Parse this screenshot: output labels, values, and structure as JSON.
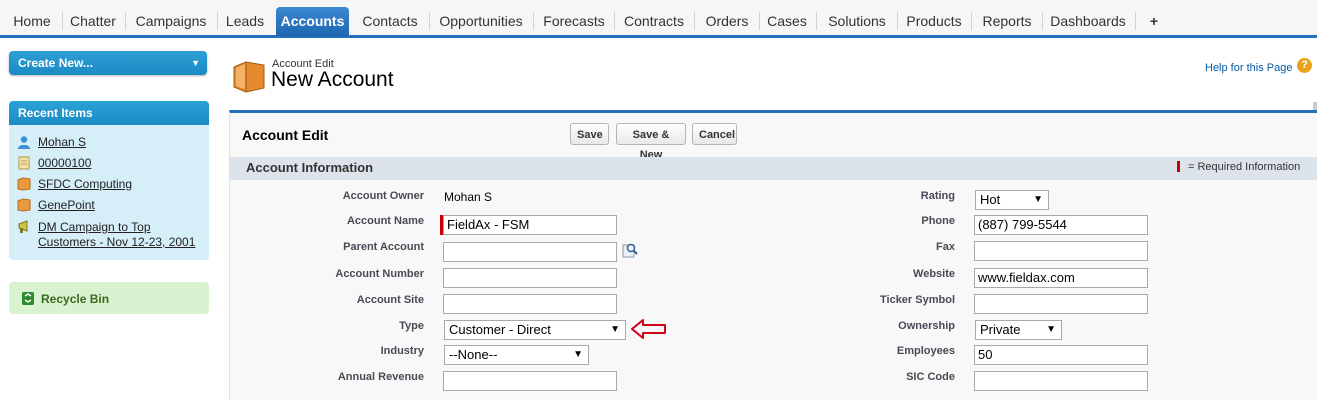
{
  "nav": {
    "tabs": [
      "Home",
      "Chatter",
      "Campaigns",
      "Leads",
      "Accounts",
      "Contacts",
      "Opportunities",
      "Forecasts",
      "Contracts",
      "Orders",
      "Cases",
      "Solutions",
      "Products",
      "Reports",
      "Dashboards",
      "+"
    ],
    "active_tab": "Accounts"
  },
  "sidebar": {
    "create_new_label": "Create New...",
    "recent_items_title": "Recent Items",
    "recent_items": [
      {
        "label": "Mohan S",
        "icon": "user-icon"
      },
      {
        "label": "00000100",
        "icon": "document-icon"
      },
      {
        "label": "SFDC Computing",
        "icon": "folder-icon"
      },
      {
        "label": "GenePoint",
        "icon": "folder-icon"
      },
      {
        "label": "DM Campaign to Top Customers - Nov 12-23, 2001",
        "icon": "campaign-icon"
      }
    ],
    "recycle_bin_label": "Recycle Bin"
  },
  "header": {
    "subtitle": "Account Edit",
    "title": "New Account",
    "help_link": "Help for this Page"
  },
  "form": {
    "panel_title": "Account Edit",
    "buttons": {
      "save": "Save",
      "save_new": "Save & New",
      "cancel": "Cancel"
    },
    "section_title": "Account Information",
    "required_info": "= Required Information",
    "left": [
      {
        "label": "Account Owner",
        "value": "Mohan S",
        "kind": "text"
      },
      {
        "label": "Account Name",
        "value": "FieldAx - FSM",
        "kind": "input",
        "required": true
      },
      {
        "label": "Parent Account",
        "value": "",
        "kind": "lookup"
      },
      {
        "label": "Account Number",
        "value": "",
        "kind": "input"
      },
      {
        "label": "Account Site",
        "value": "",
        "kind": "input"
      },
      {
        "label": "Type",
        "value": "Customer - Direct",
        "kind": "select"
      },
      {
        "label": "Industry",
        "value": "--None--",
        "kind": "select"
      },
      {
        "label": "Annual Revenue",
        "value": "",
        "kind": "input"
      }
    ],
    "right": [
      {
        "label": "Rating",
        "value": "Hot",
        "kind": "select"
      },
      {
        "label": "Phone",
        "value": "(887) 799-5544",
        "kind": "input"
      },
      {
        "label": "Fax",
        "value": "",
        "kind": "input"
      },
      {
        "label": "Website",
        "value": "www.fieldax.com",
        "kind": "input"
      },
      {
        "label": "Ticker Symbol",
        "value": "",
        "kind": "input"
      },
      {
        "label": "Ownership",
        "value": "Private",
        "kind": "select"
      },
      {
        "label": "Employees",
        "value": "50",
        "kind": "input"
      },
      {
        "label": "SIC Code",
        "value": "",
        "kind": "input"
      }
    ]
  },
  "colors": {
    "brand_blue": "#236fbd",
    "sidebar_blue": "#1a8ac3",
    "required_red": "#cc0000",
    "annotation_red": "#d0021b"
  }
}
